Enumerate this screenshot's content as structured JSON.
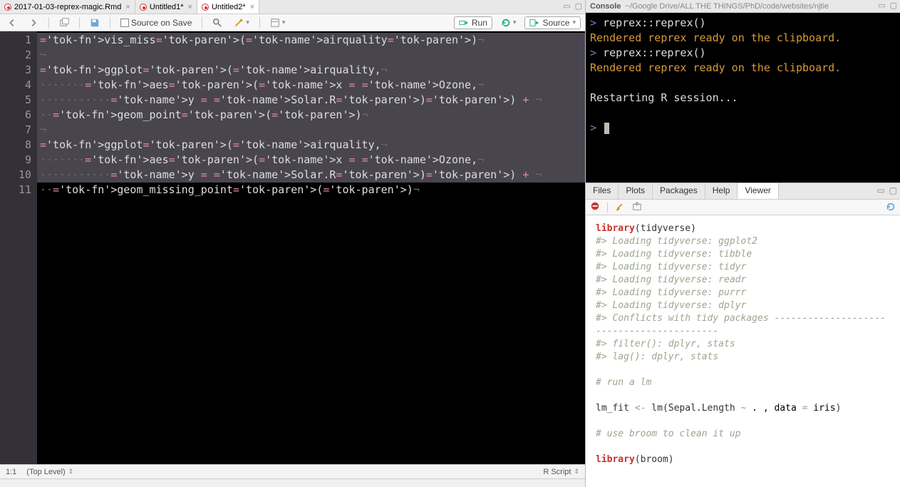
{
  "tabs": [
    {
      "label": "2017-01-03-reprex-magic.Rmd",
      "active": false
    },
    {
      "label": "Untitled1*",
      "active": false
    },
    {
      "label": "Untitled2*",
      "active": true
    }
  ],
  "toolbar": {
    "source_on_save": "Source on Save",
    "run": "Run",
    "source": "Source"
  },
  "code_lines": [
    {
      "n": "1",
      "sel": true,
      "raw": "vis_miss(airquality)"
    },
    {
      "n": "2",
      "sel": true,
      "raw": ""
    },
    {
      "n": "3",
      "sel": true,
      "raw": "ggplot(airquality,"
    },
    {
      "n": "4",
      "sel": true,
      "raw": "       aes(x = Ozone,"
    },
    {
      "n": "5",
      "sel": true,
      "raw": "           y = Solar.R)) + "
    },
    {
      "n": "6",
      "sel": true,
      "raw": "  geom_point()"
    },
    {
      "n": "7",
      "sel": true,
      "raw": ""
    },
    {
      "n": "8",
      "sel": true,
      "raw": "ggplot(airquality,"
    },
    {
      "n": "9",
      "sel": true,
      "raw": "       aes(x = Ozone,"
    },
    {
      "n": "10",
      "sel": true,
      "raw": "           y = Solar.R)) + "
    },
    {
      "n": "11",
      "sel": false,
      "raw": "  geom_missing_point()"
    }
  ],
  "status": {
    "pos": "1:1",
    "scope": "(Top Level)",
    "lang": "R Script"
  },
  "console": {
    "title": "Console",
    "path": "~/Google Drive/ALL THE THINGS/PhD/code/websites/njtie",
    "lines": [
      {
        "type": "prompt",
        "text": "> ",
        "code": "reprex::reprex()"
      },
      {
        "type": "out",
        "text": "Rendered reprex ready on the clipboard."
      },
      {
        "type": "prompt",
        "text": "> ",
        "code": "reprex::reprex()"
      },
      {
        "type": "out",
        "text": "Rendered reprex ready on the clipboard."
      },
      {
        "type": "blank"
      },
      {
        "type": "plain",
        "text": "Restarting R session..."
      },
      {
        "type": "blank"
      },
      {
        "type": "prompt",
        "text": "> ",
        "code": ""
      }
    ]
  },
  "panel_tabs": [
    "Files",
    "Plots",
    "Packages",
    "Help",
    "Viewer"
  ],
  "panel_active": "Viewer",
  "viewer_lines": [
    {
      "t": "code",
      "html": "<span class='v-kw'>library</span><span class='v-paren'>(</span><span class='v-name'>tidyverse</span><span class='v-paren'>)</span>"
    },
    {
      "t": "comment",
      "text": "#> Loading tidyverse: ggplot2"
    },
    {
      "t": "comment",
      "text": "#> Loading tidyverse: tibble"
    },
    {
      "t": "comment",
      "text": "#> Loading tidyverse: tidyr"
    },
    {
      "t": "comment",
      "text": "#> Loading tidyverse: readr"
    },
    {
      "t": "comment",
      "text": "#> Loading tidyverse: purrr"
    },
    {
      "t": "comment",
      "text": "#> Loading tidyverse: dplyr"
    },
    {
      "t": "comment",
      "text": "#> Conflicts with tidy packages --------------------"
    },
    {
      "t": "comment",
      "text": "----------------------"
    },
    {
      "t": "comment",
      "text": "#> filter(): dplyr, stats"
    },
    {
      "t": "comment",
      "text": "#> lag():    dplyr, stats"
    },
    {
      "t": "blank"
    },
    {
      "t": "comment",
      "text": "# run a lm"
    },
    {
      "t": "blank"
    },
    {
      "t": "code",
      "html": "<span class='v-name'>lm_fit</span> <span class='v-op'>&lt;-</span> <span class='v-name'>lm</span><span class='v-paren'>(</span><span class='v-name'>Sepal.Length</span> <span class='v-op'>~</span> . , data <span class='v-op'>=</span> iris<span class='v-paren'>)</span>"
    },
    {
      "t": "blank"
    },
    {
      "t": "comment",
      "text": "# use broom to clean it up"
    },
    {
      "t": "blank"
    },
    {
      "t": "code",
      "html": "<span class='v-kw'>library</span><span class='v-paren'>(</span><span class='v-name'>broom</span><span class='v-paren'>)</span>"
    }
  ]
}
